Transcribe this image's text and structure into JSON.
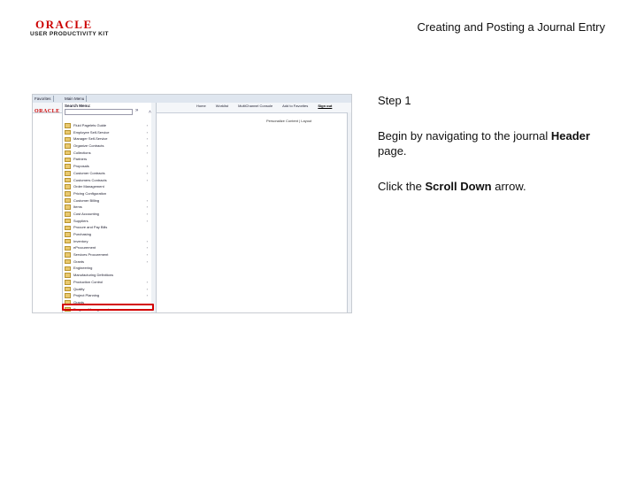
{
  "header": {
    "brand": "ORACLE",
    "brand_sub": "USER PRODUCTIVITY KIT",
    "doc_title": "Creating and Posting a Journal Entry"
  },
  "screenshot": {
    "tabs": [
      "Favorites",
      "Main Menu"
    ],
    "menu_title": "Search Menu:",
    "nav_links": [
      "Home",
      "Worklist",
      "MultiChannel Console",
      "Add to Favorites",
      "Sign out"
    ],
    "personalize": "Personalize Content | Layout",
    "menu_items": [
      {
        "label": "Fluid Pagelets Guide",
        "arrow": true
      },
      {
        "label": "Employee Self-Service",
        "arrow": true
      },
      {
        "label": "Manager Self-Service",
        "arrow": true
      },
      {
        "label": "Organize Contracts",
        "arrow": true
      },
      {
        "label": "Collections",
        "arrow": true
      },
      {
        "label": "Partners",
        "arrow": false
      },
      {
        "label": "Proposals",
        "arrow": true
      },
      {
        "label": "Customer Contracts",
        "arrow": true
      },
      {
        "label": "Customers Contracts",
        "arrow": true
      },
      {
        "label": "Order Management",
        "arrow": false
      },
      {
        "label": "Pricing Configuration",
        "arrow": false
      },
      {
        "label": "Customer Billing",
        "arrow": true
      },
      {
        "label": "Items",
        "arrow": true
      },
      {
        "label": "Cost Accounting",
        "arrow": true
      },
      {
        "label": "Suppliers",
        "arrow": true
      },
      {
        "label": "Procure and Pay Bills",
        "arrow": false
      },
      {
        "label": "Purchasing",
        "arrow": false
      },
      {
        "label": "Inventory",
        "arrow": true
      },
      {
        "label": "eProcurement",
        "arrow": true
      },
      {
        "label": "Services Procurement",
        "arrow": true
      },
      {
        "label": "Grants",
        "arrow": true
      },
      {
        "label": "Engineering",
        "arrow": false
      },
      {
        "label": "Manufacturing Definitions",
        "arrow": false
      },
      {
        "label": "Production Control",
        "arrow": true
      },
      {
        "label": "Quality",
        "arrow": true
      },
      {
        "label": "Project Planning",
        "arrow": true
      },
      {
        "label": "Grants",
        "arrow": false
      },
      {
        "label": "Program Management",
        "arrow": true
      }
    ]
  },
  "instructions": {
    "step": "Step 1",
    "line1_pre": "Begin by navigating to the journal",
    "line1_bold": "Header",
    "line1_post": "page.",
    "line2_pre": "Click the",
    "line2_bold": "Scroll Down",
    "line2_post": "arrow."
  },
  "colors": {
    "highlight": "#d40000",
    "brand_red": "#cc0000"
  }
}
